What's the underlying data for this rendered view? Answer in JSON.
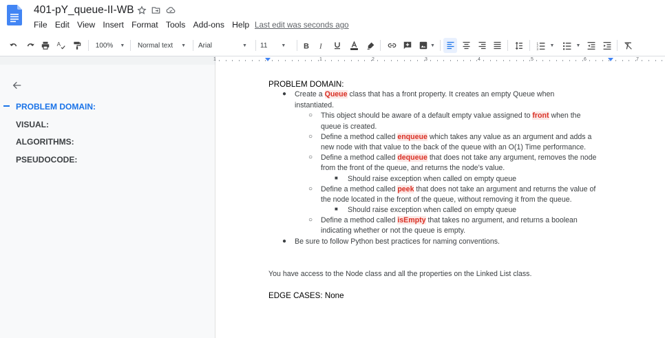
{
  "doc_title": "401-pY_queue-II-WB",
  "menu": [
    "File",
    "Edit",
    "View",
    "Insert",
    "Format",
    "Tools",
    "Add-ons",
    "Help"
  ],
  "last_edit": "Last edit was seconds ago",
  "toolbar": {
    "zoom": "100%",
    "style": "Normal text",
    "font": "Arial",
    "font_size": "11"
  },
  "ruler_numbers": [
    "1",
    "1",
    "2",
    "3",
    "4",
    "5",
    "6",
    "7"
  ],
  "outline": [
    "PROBLEM DOMAIN:",
    "VISUAL:",
    "ALGORITHMS:",
    "PSEUDOCODE:"
  ],
  "doc": {
    "heading": "PROBLEM DOMAIN:",
    "l1a": "Create a ",
    "l1hl": "Queue",
    "l1b": " class that has a front property. It creates an empty Queue when",
    "l1c": "instantiated.",
    "l2a": "This object should be aware of a default empty value assigned to ",
    "l2hl": "front",
    "l2b": " when the",
    "l2c": "queue is created.",
    "l3a": "Define a method called ",
    "l3hl": "enqueue",
    "l3b": " which takes any value as an argument and adds a",
    "l3c": "new node with that value to the back of the queue with an O(1) Time performance.",
    "l4a": "Define a method called ",
    "l4hl": "dequeue",
    "l4b": " that does not take any argument, removes the node",
    "l4c": "from the front of the queue, and returns the node’s value.",
    "l5": "Should raise exception when called on empty queue",
    "l6a": "Define a method called ",
    "l6hl": "peek",
    "l6b": " that does not take an argument and returns the value of",
    "l6c": "the node located in the front of the queue, without removing it from the queue.",
    "l7": "Should raise exception when called on empty queue",
    "l8a": "Define a method called ",
    "l8hl": "isEmpty",
    "l8b": " that takes no argument, and returns a boolean",
    "l8c": "indicating whether or not the queue is empty.",
    "l9": "Be sure to follow Python best practices for naming conventions.",
    "access": "You have access to the Node class and all the properties on the Linked List class.",
    "edge": "EDGE CASES:  None"
  },
  "colors": {
    "accent": "#1a73e8",
    "highlight_bg": "#fce8e6",
    "highlight_text": "#d93025"
  }
}
